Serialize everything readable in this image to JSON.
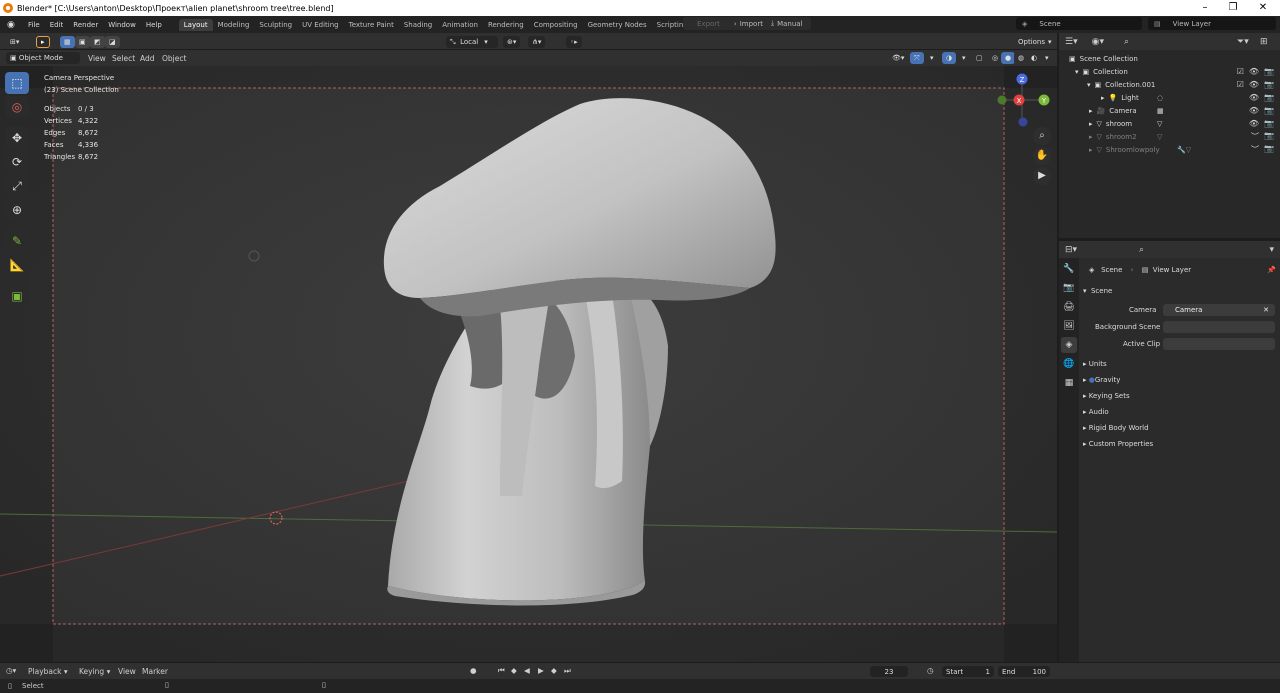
{
  "window": {
    "title": "Blender* [C:\\Users\\anton\\Desktop\\Проект\\alien planet\\shroom tree\\tree.blend]",
    "controls": {
      "minimize": "–",
      "maximize": "❐",
      "close": "✕"
    }
  },
  "menu": {
    "items": [
      "File",
      "Edit",
      "Render",
      "Window",
      "Help"
    ],
    "tabs": [
      "Layout",
      "Modeling",
      "Sculpting",
      "UV Editing",
      "Texture Paint",
      "Shading",
      "Animation",
      "Rendering",
      "Compositing",
      "Geometry Nodes",
      "Scripting"
    ],
    "active_tab": "Layout",
    "plus": "+",
    "export": "Export",
    "import": "Import",
    "manual": "Manual",
    "scene": "Scene",
    "view_layer": "View Layer"
  },
  "viewport_header": {
    "transform_orientation": "Local",
    "options": "Options",
    "mode": "Object Mode",
    "menus": [
      "View",
      "Select",
      "Add",
      "Object"
    ]
  },
  "viewport": {
    "camera_label": "Camera Perspective",
    "collection_label": "(23) Scene Collection",
    "stats": [
      {
        "label": "Objects",
        "value": "0 / 3"
      },
      {
        "label": "Vertices",
        "value": "4,322"
      },
      {
        "label": "Edges",
        "value": "8,672"
      },
      {
        "label": "Faces",
        "value": "4,336"
      },
      {
        "label": "Triangles",
        "value": "8,672"
      }
    ],
    "gizmo": {
      "x": "X",
      "y": "Y",
      "z": "Z"
    }
  },
  "outliner": {
    "title": "Scene Collection",
    "rows": [
      {
        "label": "Collection",
        "faded": false
      },
      {
        "label": "Collection.001",
        "faded": false
      },
      {
        "label": "Light",
        "faded": false
      },
      {
        "label": "Camera",
        "faded": false
      },
      {
        "label": "shroom",
        "faded": false
      },
      {
        "label": "shroom2",
        "faded": true
      },
      {
        "label": "Shroomlowpoly",
        "faded": true
      }
    ]
  },
  "properties": {
    "breadcrumb_scene": "Scene",
    "breadcrumb_view_layer": "View Layer",
    "section": "Scene",
    "camera_label": "Camera",
    "camera_value": "Camera",
    "background_scene_label": "Background Scene",
    "active_clip_label": "Active Clip",
    "panels": [
      "Units",
      "Gravity",
      "Keying Sets",
      "Audio",
      "Rigid Body World",
      "Custom Properties"
    ]
  },
  "timeline": {
    "menus": [
      "Playback",
      "Keying",
      "View",
      "Marker"
    ],
    "current_frame": "23",
    "start_label": "Start",
    "start_value": "1",
    "end_label": "End",
    "end_value": "100"
  },
  "status": {
    "select": "Select"
  },
  "colors": {
    "accent": "#4772b3",
    "x_axis": "#e04040",
    "y_axis": "#7db93b",
    "z_axis": "#4a6ce0"
  }
}
